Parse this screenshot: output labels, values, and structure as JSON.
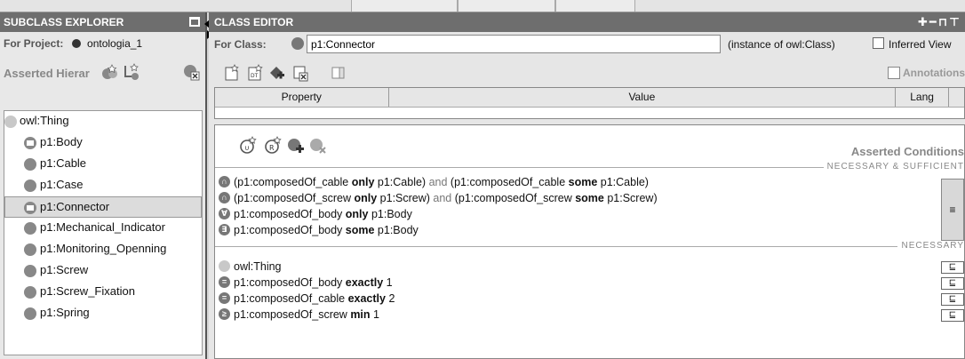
{
  "left_panel": {
    "title": "SUBCLASS EXPLORER",
    "project_label": "For Project:",
    "project_name": "ontologia_1",
    "hierarchy_label": "Asserted Hierar",
    "tree": [
      {
        "label": "owl:Thing",
        "icon": "light-circle-icon"
      },
      {
        "label": "p1:Body",
        "icon": "equivalent-class-icon"
      },
      {
        "label": "p1:Cable",
        "icon": "class-icon"
      },
      {
        "label": "p1:Case",
        "icon": "class-icon"
      },
      {
        "label": "p1:Connector",
        "icon": "equivalent-class-icon",
        "selected": true
      },
      {
        "label": "p1:Mechanical_Indicator",
        "icon": "class-icon"
      },
      {
        "label": "p1:Monitoring_Openning",
        "icon": "class-icon"
      },
      {
        "label": "p1:Screw",
        "icon": "class-icon"
      },
      {
        "label": "p1:Screw_Fixation",
        "icon": "class-icon"
      },
      {
        "label": "p1:Spring",
        "icon": "class-icon"
      }
    ]
  },
  "right_panel": {
    "title": "CLASS EDITOR",
    "class_label": "For Class:",
    "class_value": "p1:Connector",
    "instance_of": "(instance of owl:Class)",
    "inferred_label": "Inferred View",
    "annotations_label": "Annotations",
    "table_headers": {
      "property": "Property",
      "value": "Value",
      "lang": "Lang"
    },
    "conditions_title": "Asserted Conditions",
    "section_nec_suf": "NECESSARY & SUFFICIENT",
    "section_nec": "NECESSARY",
    "side_symbol": "≡",
    "sub_symbol": "⊑",
    "ns_conditions": {
      "c1": {
        "a": "(p1:composedOf_cable ",
        "k1": "only",
        "b": " p1:Cable) ",
        "and": "and",
        "c": " (p1:composedOf_cable ",
        "k2": "some",
        "d": " p1:Cable)"
      },
      "c2": {
        "a": "(p1:composedOf_screw ",
        "k1": "only",
        "b": " p1:Screw) ",
        "and": "and",
        "c": " (p1:composedOf_screw ",
        "k2": "some",
        "d": " p1:Screw)"
      },
      "c3": {
        "a": "p1:composedOf_body ",
        "k": "only",
        "b": " p1:Body"
      },
      "c4": {
        "a": "p1:composedOf_body ",
        "k": "some",
        "b": " p1:Body"
      }
    },
    "n_conditions": {
      "c1": {
        "a": "owl:Thing"
      },
      "c2": {
        "a": "p1:composedOf_body ",
        "k": "exactly",
        "b": " 1"
      },
      "c3": {
        "a": "p1:composedOf_cable ",
        "k": "exactly",
        "b": " 2"
      },
      "c4": {
        "a": "p1:composedOf_screw ",
        "k": "min",
        "b": " 1"
      }
    }
  }
}
